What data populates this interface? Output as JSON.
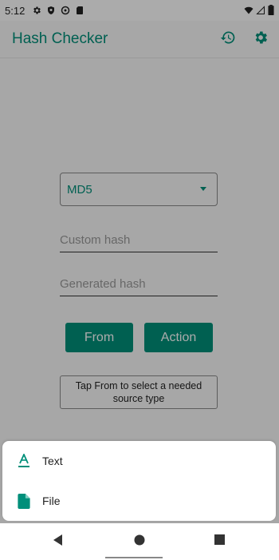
{
  "status_bar": {
    "time": "5:12",
    "left_icons": [
      "gear-icon",
      "shield-icon",
      "at-icon",
      "sd-card-icon"
    ],
    "right_icons": [
      "wifi-icon",
      "signal-icon",
      "battery-icon"
    ]
  },
  "app_bar": {
    "title": "Hash Checker",
    "actions": [
      "history-icon",
      "settings-icon"
    ]
  },
  "main": {
    "algorithm_dropdown": {
      "selected": "MD5"
    },
    "custom_hash": {
      "placeholder": "Custom hash",
      "value": ""
    },
    "generated_hash": {
      "placeholder": "Generated hash",
      "value": ""
    },
    "from_button": "From",
    "action_button": "Action",
    "hint_text": "Tap From to select a needed source type"
  },
  "bottom_sheet": {
    "items": [
      {
        "label": "Text",
        "icon": "text-format-icon"
      },
      {
        "label": "File",
        "icon": "file-icon"
      }
    ]
  },
  "nav_bar": {
    "buttons": [
      "back-icon",
      "home-icon",
      "recents-icon"
    ]
  },
  "colors": {
    "accent": "#008f7a",
    "scrim": "rgba(0,0,0,0.33)"
  }
}
